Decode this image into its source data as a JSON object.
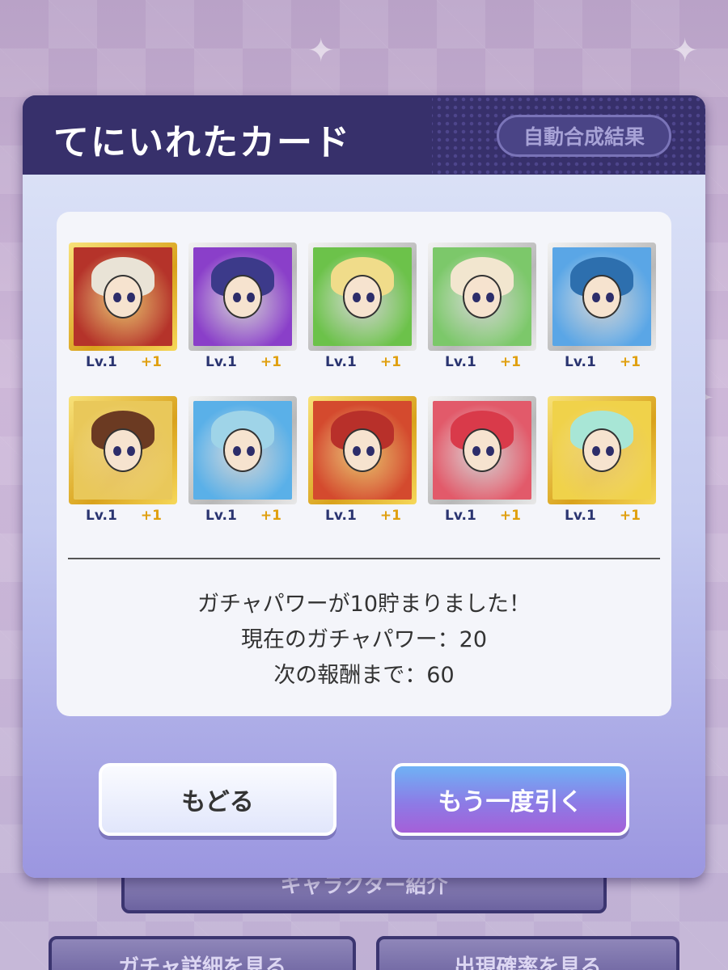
{
  "background": {
    "character_intro_label": "キャラクター紹介",
    "gacha_detail_label": "ガチャ詳細を見る",
    "drop_rate_label": "出現確率を見る"
  },
  "dialog": {
    "title": "てにいれたカード",
    "auto_merge_label": "自動合成結果",
    "cards": [
      {
        "level": "Lv.1",
        "bonus": "+1",
        "frame": "gold",
        "art": "#b5332a",
        "hair": "#e9e3d6"
      },
      {
        "level": "Lv.1",
        "bonus": "+1",
        "frame": "silver",
        "art": "#8a3fc9",
        "hair": "#3c3a8a"
      },
      {
        "level": "Lv.1",
        "bonus": "+1",
        "frame": "silver",
        "art": "#6cc24a",
        "hair": "#f0dc8a"
      },
      {
        "level": "Lv.1",
        "bonus": "+1",
        "frame": "silver",
        "art": "#7cc86a",
        "hair": "#f2e6cf"
      },
      {
        "level": "Lv.1",
        "bonus": "+1",
        "frame": "silver",
        "art": "#5aa6e6",
        "hair": "#2d6fae"
      },
      {
        "level": "Lv.1",
        "bonus": "+1",
        "frame": "gold",
        "art": "#e9c85a",
        "hair": "#6b3a22"
      },
      {
        "level": "Lv.1",
        "bonus": "+1",
        "frame": "silver",
        "art": "#5ab0e8",
        "hair": "#9fd4e8"
      },
      {
        "level": "Lv.1",
        "bonus": "+1",
        "frame": "gold",
        "art": "#d44a2e",
        "hair": "#b8302a"
      },
      {
        "level": "Lv.1",
        "bonus": "+1",
        "frame": "silver",
        "art": "#e25a6a",
        "hair": "#d93a4a"
      },
      {
        "level": "Lv.1",
        "bonus": "+1",
        "frame": "gold",
        "art": "#f0d24a",
        "hair": "#a8e6d6"
      }
    ],
    "info_lines": [
      "ガチャパワーが10貯まりました！",
      "現在のガチャパワー：20",
      "次の報酬まで：60"
    ],
    "back_label": "もどる",
    "draw_again_label": "もう一度引く"
  }
}
